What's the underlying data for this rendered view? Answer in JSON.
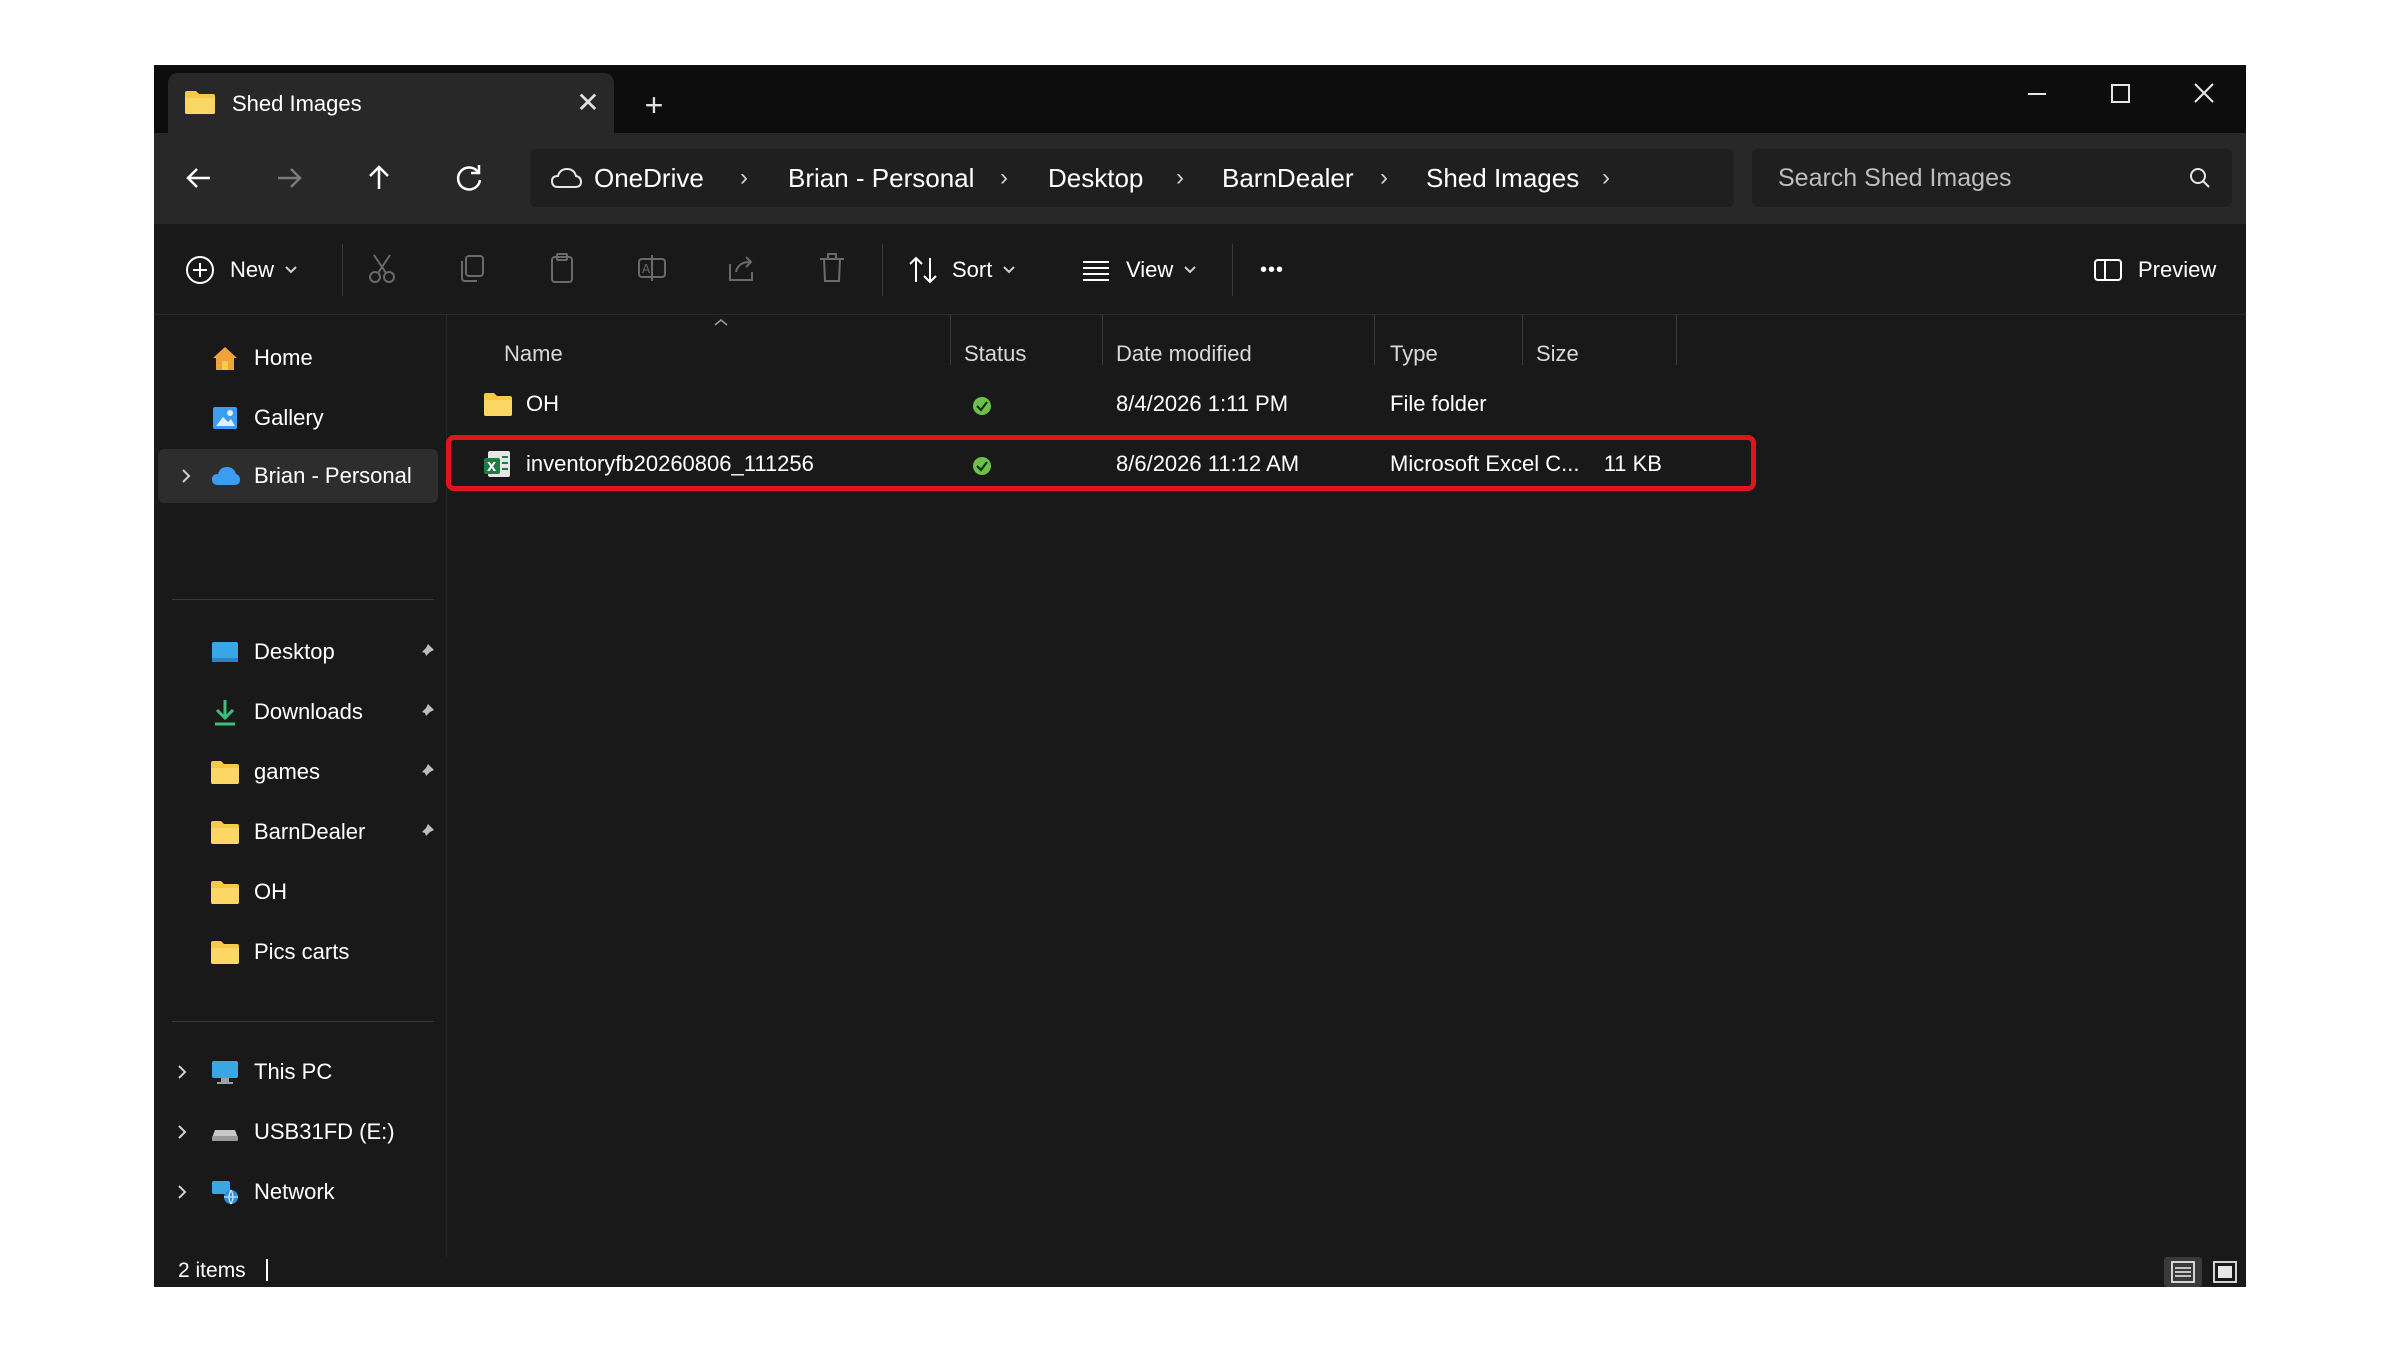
{
  "tab": {
    "title": "Shed Images",
    "close": "✕",
    "new_tab": "+"
  },
  "window_controls": {
    "minimize": "—",
    "maximize": "☐",
    "close": "✕"
  },
  "nav": {
    "back": "←",
    "forward": "→",
    "up": "↑",
    "refresh": "↻"
  },
  "breadcrumbs": [
    "OneDrive",
    "Brian - Personal",
    "Desktop",
    "BarnDealer",
    "Shed Images"
  ],
  "breadcrumb_separator": "›",
  "search": {
    "placeholder": "Search Shed Images"
  },
  "commandbar": {
    "new_label": "New",
    "sort_label": "Sort",
    "view_label": "View",
    "more_label": "•••",
    "preview_label": "Preview"
  },
  "sidebar": {
    "top": [
      {
        "label": "Home",
        "icon": "home-icon"
      },
      {
        "label": "Gallery",
        "icon": "gallery-icon"
      },
      {
        "label": "Brian - Personal",
        "icon": "cloud-icon"
      }
    ],
    "pinned": [
      {
        "label": "Desktop",
        "icon": "desktop-icon"
      },
      {
        "label": "Downloads",
        "icon": "download-icon"
      },
      {
        "label": "games",
        "icon": "folder-icon"
      },
      {
        "label": "BarnDealer",
        "icon": "folder-icon"
      },
      {
        "label": "OH",
        "icon": "folder-icon"
      },
      {
        "label": "Pics carts",
        "icon": "folder-icon"
      }
    ],
    "devices": [
      {
        "label": "This PC",
        "icon": "computer-icon"
      },
      {
        "label": "USB31FD (E:)",
        "icon": "drive-icon"
      },
      {
        "label": "Network",
        "icon": "network-icon"
      }
    ]
  },
  "columns": {
    "name": "Name",
    "status": "Status",
    "date": "Date modified",
    "type": "Type",
    "size": "Size"
  },
  "files": [
    {
      "name": "OH",
      "icon": "folder-icon",
      "status": "synced",
      "date": "8/4/2026 1:11 PM",
      "type": "File folder",
      "size": ""
    },
    {
      "name": "inventoryfb20260806_111256",
      "icon": "excel-csv-icon",
      "status": "synced",
      "date": "8/6/2026 11:12 AM",
      "type": "Microsoft Excel C...",
      "size": "11 KB"
    }
  ],
  "statusbar": {
    "count": "2 items"
  },
  "colors": {
    "highlight": "#e0141b",
    "folder": "#f7c948",
    "sync": "#6cc04a",
    "onedrive": "#3b9cf2"
  }
}
